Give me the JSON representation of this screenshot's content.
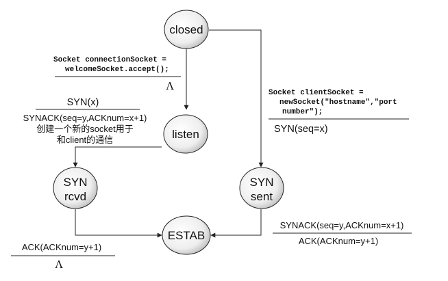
{
  "states": {
    "closed": "closed",
    "listen": "listen",
    "syn_rcvd_line1": "SYN",
    "syn_rcvd_line2": "rcvd",
    "syn_sent_line1": "SYN",
    "syn_sent_line2": "sent",
    "estab": "ESTAB"
  },
  "labels": {
    "server_accept_line1": "Socket connectionSocket =",
    "server_accept_line2": "welcomeSocket.accept();",
    "server_accept_action": "Λ",
    "listen_event": "SYN(x)",
    "listen_action_line1": "SYNACK(seq=y,ACKnum=x+1)",
    "listen_action_line2": "创建一个新的socket用于",
    "listen_action_line3": "和client的通信",
    "rcvd_event": "ACK(ACKnum=y+1)",
    "rcvd_action": "Λ",
    "client_socket_line1": "Socket clientSocket =",
    "client_socket_line2": "newSocket(\"hostname\",\"port",
    "client_socket_line3": "number\");",
    "client_action": "SYN(seq=x)",
    "sent_event": "SYNACK(seq=y,ACKnum=x+1)",
    "sent_action": "ACK(ACKnum=y+1)"
  },
  "colors": {
    "state_fill_light": "#ffffff",
    "state_fill_dark": "#cccccc",
    "line": "#222222"
  }
}
